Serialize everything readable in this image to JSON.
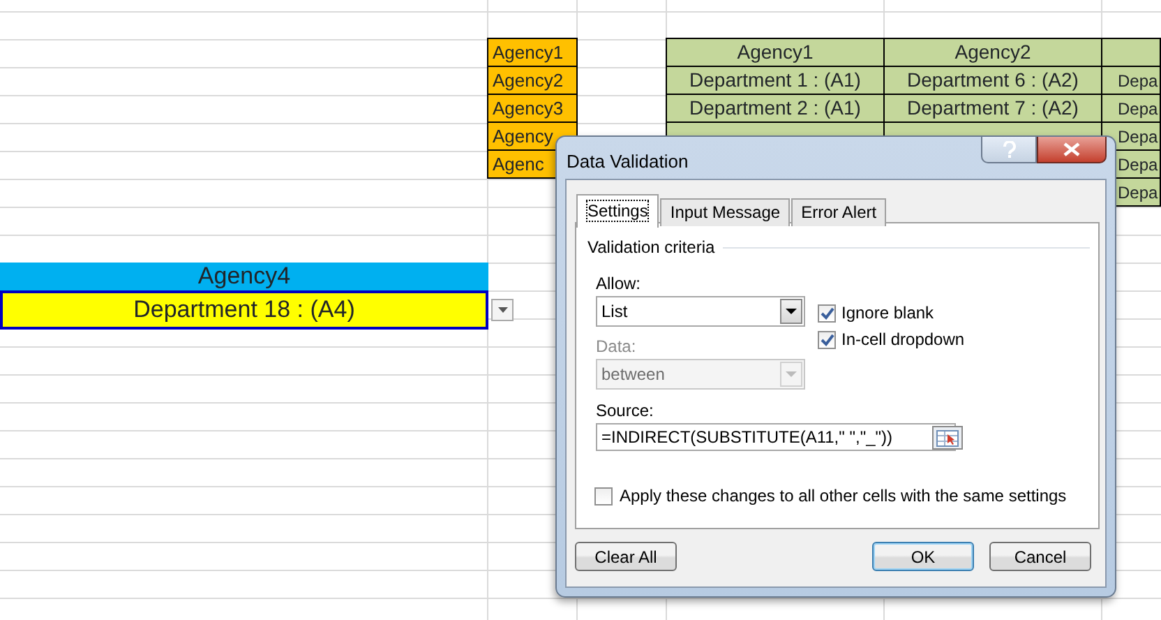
{
  "sheet": {
    "agency_list": [
      "Agency1",
      "Agency2",
      "Agency3",
      "Agency",
      "Agenc"
    ],
    "table": {
      "columns": [
        "Agency1",
        "Agency2"
      ],
      "rows": [
        [
          "Department 1 : (A1)",
          "Department 6 : (A2)"
        ],
        [
          "Department 2 : (A1)",
          "Department 7 : (A2)"
        ]
      ],
      "column_3": [
        "Depa",
        "Depa",
        "Depa",
        "Depa",
        "Depa"
      ]
    },
    "selection": {
      "header": "Agency4",
      "value": "Department 18 : (A4)"
    }
  },
  "dialog": {
    "title": "Data Validation",
    "tabs": [
      {
        "label": "Settings",
        "selected": true
      },
      {
        "label": "Input Message",
        "selected": false
      },
      {
        "label": "Error Alert",
        "selected": false
      }
    ],
    "group_title": "Validation criteria",
    "allow": {
      "label": "Allow:",
      "value": "List",
      "disabled": false
    },
    "data": {
      "label": "Data:",
      "value": "between",
      "disabled": true
    },
    "checkboxes": [
      {
        "label": "Ignore blank",
        "checked": true
      },
      {
        "label": "In-cell dropdown",
        "checked": true
      }
    ],
    "source": {
      "label": "Source:",
      "value": "=INDIRECT(SUBSTITUTE(A11,\" \",\"_\"))"
    },
    "apply": {
      "label": "Apply these changes to all other cells with the same settings",
      "checked": false
    },
    "buttons": [
      {
        "label": "Clear All",
        "kind": "plain"
      },
      {
        "label": "OK",
        "kind": "default"
      },
      {
        "label": "Cancel",
        "kind": "plain"
      }
    ]
  }
}
